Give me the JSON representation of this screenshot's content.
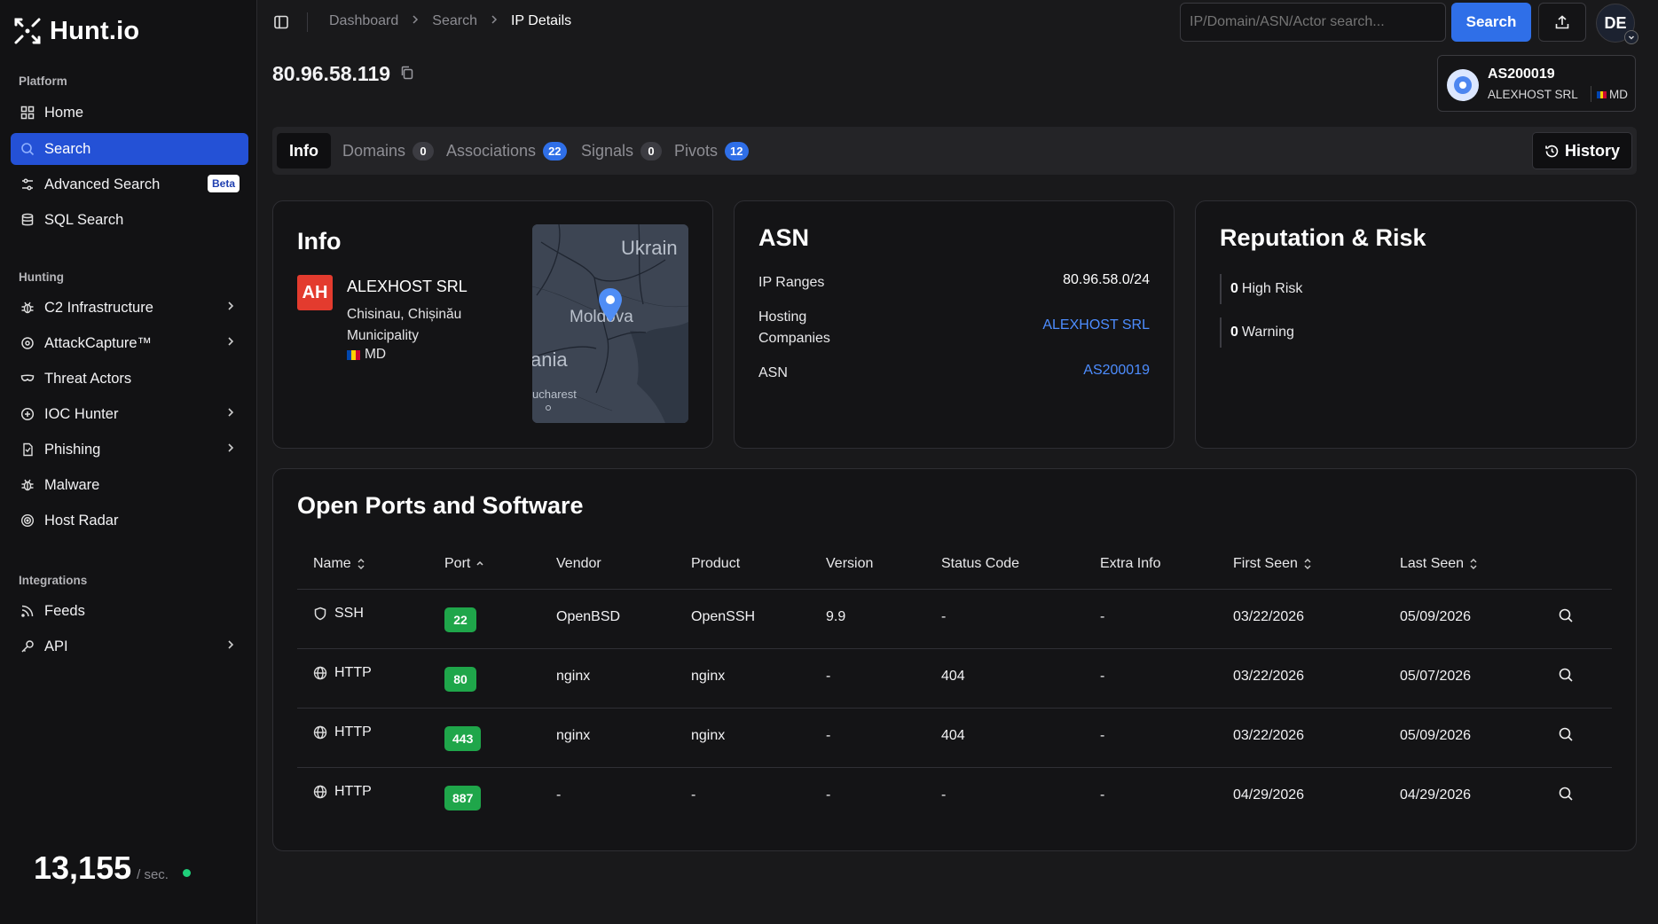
{
  "app": {
    "name": "Hunt.io"
  },
  "sidebar": {
    "sections": {
      "platform": "Platform",
      "hunting": "Hunting",
      "integrations": "Integrations"
    },
    "items": [
      {
        "label": "Home",
        "icon": "grid-icon"
      },
      {
        "label": "Search",
        "icon": "search-icon",
        "active": true
      },
      {
        "label": "Advanced Search",
        "icon": "sliders-icon",
        "badge": "Beta"
      },
      {
        "label": "SQL Search",
        "icon": "database-icon"
      },
      {
        "label": "C2 Infrastructure",
        "icon": "bug-icon",
        "chevron": true
      },
      {
        "label": "AttackCapture™",
        "icon": "target-icon",
        "chevron": true
      },
      {
        "label": "Threat Actors",
        "icon": "mask-icon"
      },
      {
        "label": "IOC Hunter",
        "icon": "plus-circle-icon",
        "chevron": true
      },
      {
        "label": "Phishing",
        "icon": "phish-icon",
        "chevron": true
      },
      {
        "label": "Malware",
        "icon": "bug-icon"
      },
      {
        "label": "Host Radar",
        "icon": "radar-icon"
      },
      {
        "label": "Feeds",
        "icon": "rss-icon"
      },
      {
        "label": "API",
        "icon": "key-icon",
        "chevron": true
      }
    ],
    "counter": {
      "value": "13,155",
      "unit": "/ sec.",
      "status_color": "#1fcf7a"
    }
  },
  "topbar": {
    "breadcrumb": [
      "Dashboard",
      "Search",
      "IP Details"
    ],
    "search_placeholder": "IP/Domain/ASN/Actor search...",
    "search_button": "Search",
    "avatar_initials": "DE"
  },
  "header": {
    "ip": "80.96.58.119",
    "asn_chip": {
      "asn": "AS200019",
      "org": "ALEXHOST SRL",
      "country": "MD"
    }
  },
  "tabs": [
    {
      "label": "Info",
      "active": true
    },
    {
      "label": "Domains",
      "count": "0",
      "count_style": "gray"
    },
    {
      "label": "Associations",
      "count": "22",
      "count_style": "blue"
    },
    {
      "label": "Signals",
      "count": "0",
      "count_style": "gray"
    },
    {
      "label": "Pivots",
      "count": "12",
      "count_style": "blue"
    }
  ],
  "history_button": "History",
  "info_card": {
    "title": "Info",
    "org_logo_text": "AH",
    "org_name": "ALEXHOST SRL",
    "location": "Chisinau, Chișinău Municipality",
    "country": "MD",
    "map_labels": [
      "Ukrain",
      "Moldova",
      "ania",
      "ucharest"
    ]
  },
  "asn_card": {
    "title": "ASN",
    "rows": [
      {
        "label": "IP Ranges",
        "value": "80.96.58.0/24",
        "link": false
      },
      {
        "label": "Hosting Companies",
        "value": "ALEXHOST SRL",
        "link": true
      },
      {
        "label": "ASN",
        "value": "AS200019",
        "link": true
      }
    ]
  },
  "risk_card": {
    "title": "Reputation & Risk",
    "items": [
      {
        "count": "0",
        "label": "High Risk"
      },
      {
        "count": "0",
        "label": "Warning"
      }
    ]
  },
  "ports": {
    "title": "Open Ports and Software",
    "columns": [
      "Name",
      "Port",
      "Vendor",
      "Product",
      "Version",
      "Status Code",
      "Extra Info",
      "First Seen",
      "Last Seen"
    ],
    "rows": [
      {
        "icon": "shield-icon",
        "name": "SSH",
        "port": "22",
        "vendor": "OpenBSD",
        "product": "OpenSSH",
        "version": "9.9",
        "status": "-",
        "extra": "-",
        "first_seen": "03/22/2026",
        "last_seen": "05/09/2026"
      },
      {
        "icon": "globe-icon",
        "name": "HTTP",
        "port": "80",
        "vendor": "nginx",
        "product": "nginx",
        "version": "-",
        "status": "404",
        "extra": "-",
        "first_seen": "03/22/2026",
        "last_seen": "05/07/2026"
      },
      {
        "icon": "globe-icon",
        "name": "HTTP",
        "port": "443",
        "vendor": "nginx",
        "product": "nginx",
        "version": "-",
        "status": "404",
        "extra": "-",
        "first_seen": "03/22/2026",
        "last_seen": "05/09/2026"
      },
      {
        "icon": "globe-icon",
        "name": "HTTP",
        "port": "887",
        "vendor": "-",
        "product": "-",
        "version": "-",
        "status": "-",
        "extra": "-",
        "first_seen": "04/29/2026",
        "last_seen": "04/29/2026"
      }
    ]
  },
  "colors": {
    "accent": "#2f6fe8",
    "active_nav": "#2451d6",
    "port_badge": "#1fa64a",
    "link": "#4d8dff"
  }
}
